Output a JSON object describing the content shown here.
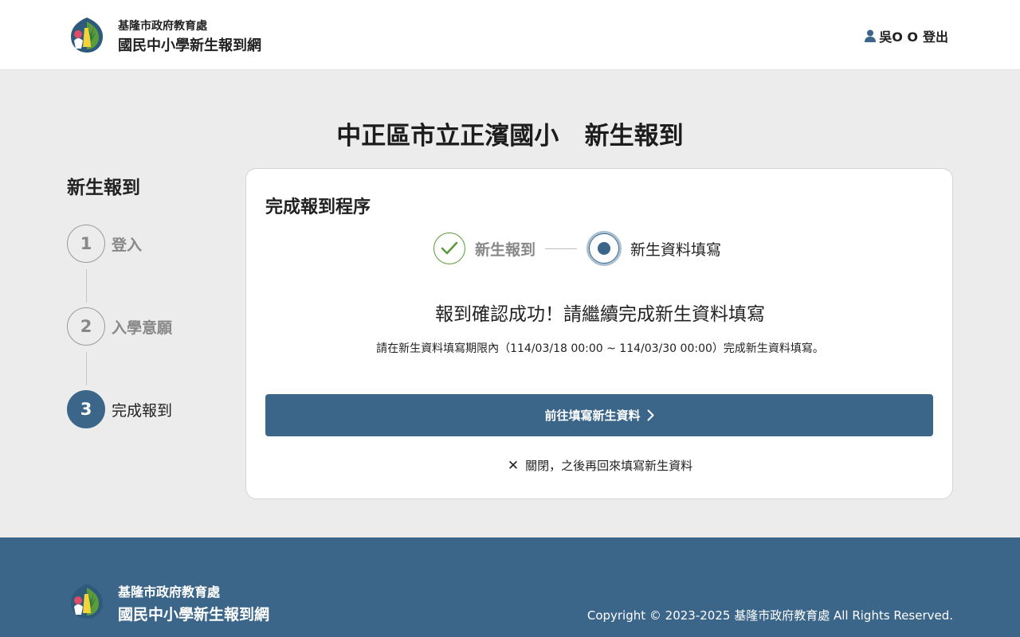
{
  "header": {
    "agency": "基隆市政府教育處",
    "site_name": "國民中小學新生報到網",
    "user_name": "吳O O",
    "logout_label": "登出"
  },
  "page": {
    "title": "中正區市立正濱國小   新生報到"
  },
  "sidebar": {
    "title": "新生報到",
    "steps": [
      {
        "number": "1",
        "label": "登入"
      },
      {
        "number": "2",
        "label": "入學意願"
      },
      {
        "number": "3",
        "label": "完成報到"
      }
    ],
    "active_step": 3
  },
  "card": {
    "title": "完成報到程序",
    "progress": [
      {
        "label": "新生報到",
        "state": "done"
      },
      {
        "label": "新生資料填寫",
        "state": "current"
      }
    ],
    "success_message": "報到確認成功！請繼續完成新生資料填寫",
    "period_message": "請在新生資料填寫期限內（114/03/18 00:00 ~ 114/03/30 00:00）完成新生資料填寫。",
    "primary_button": "前往填寫新生資料",
    "close_link": "關閉，之後再回來填寫新生資料"
  },
  "footer": {
    "agency": "基隆市政府教育處",
    "site_name": "國民中小學新生報到網",
    "copyright": "Copyright © 2023-2025 基隆市政府教育處 All Rights Reserved."
  },
  "colors": {
    "primary": "#3c6689",
    "success": "#5a9a3a",
    "background": "#ececec"
  }
}
